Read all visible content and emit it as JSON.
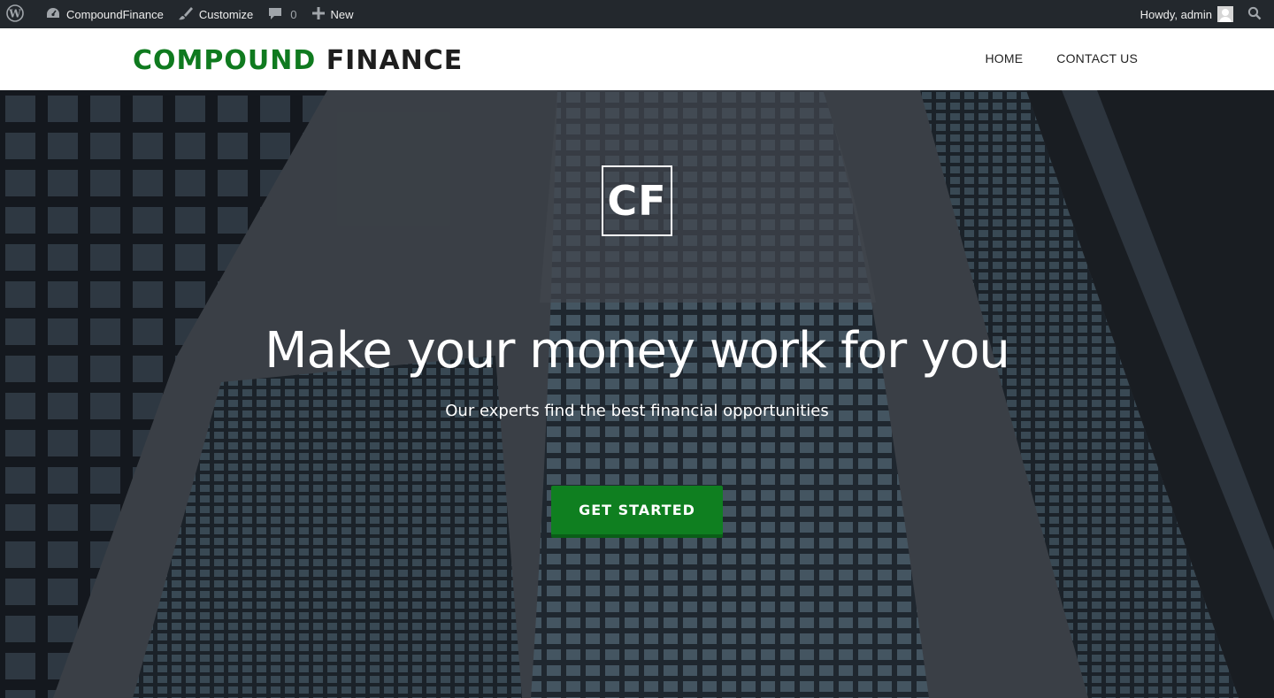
{
  "admin_bar": {
    "site_name": "CompoundFinance",
    "customize": "Customize",
    "comments_count": "0",
    "new": "New",
    "greeting": "Howdy, admin"
  },
  "header": {
    "brand_part1": "COMPOUND",
    "brand_part2": "FINANCE",
    "nav": [
      "HOME",
      "CONTACT US"
    ]
  },
  "hero": {
    "logo_text": "CF",
    "headline": "Make your money work for you",
    "subheadline": "Our experts find the best financial opportunities",
    "cta": "GET STARTED"
  },
  "colors": {
    "brand_green": "#0f7a1f",
    "admin_bar": "#23282d",
    "cta_green": "#0f7f20"
  },
  "icons": [
    "wordpress-icon",
    "dashboard-icon",
    "brush-icon",
    "comment-icon",
    "plus-icon",
    "search-icon"
  ]
}
